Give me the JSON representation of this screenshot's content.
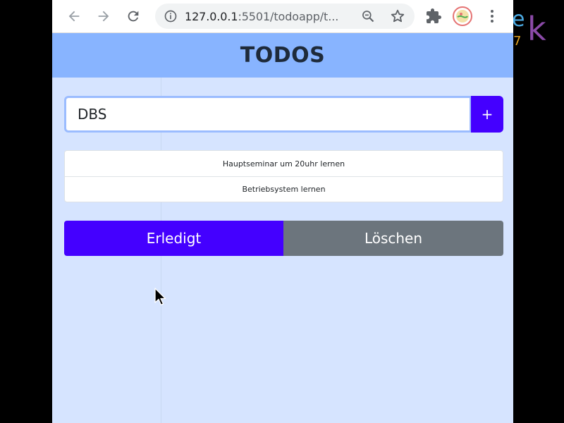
{
  "browser": {
    "url_host": "127.0.0.1",
    "url_rest": ":5501/todoapp/t..."
  },
  "app": {
    "title": "TODOS",
    "input_value": "DBS",
    "add_label": "+",
    "todos": [
      "Hauptseminar um 20uhr lernen",
      "Betriebsystem lernen"
    ],
    "done_label": "Erledigt",
    "delete_label": "Löschen"
  },
  "colors": {
    "header": "#88b4ff",
    "page": "#d6e4ff",
    "primary": "#4400ff",
    "secondary": "#6c757d"
  },
  "backdrop_logo": {
    "letter_e": "e",
    "letter_k": "k",
    "digit": "7"
  }
}
